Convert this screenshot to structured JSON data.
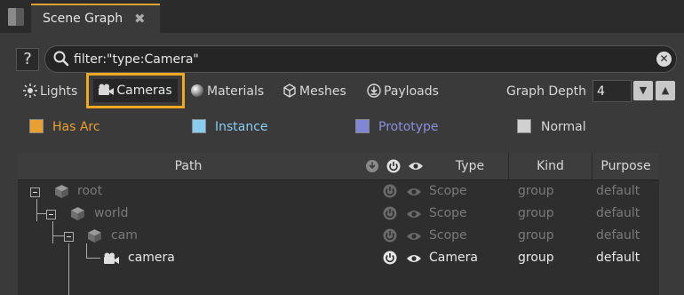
{
  "tab": {
    "title": "Scene Graph",
    "close_glyph": "✖"
  },
  "search": {
    "help_label": "?",
    "value": "filter:\"type:Camera\"",
    "clear_glyph": "✕"
  },
  "filters": [
    {
      "label": "Lights",
      "icon": "light-icon"
    },
    {
      "label": "Cameras",
      "icon": "camera-icon",
      "highlighted": true
    },
    {
      "label": "Materials",
      "icon": "material-sphere-icon"
    },
    {
      "label": "Meshes",
      "icon": "mesh-icon"
    },
    {
      "label": "Payloads",
      "icon": "payload-icon"
    }
  ],
  "graph_depth": {
    "label": "Graph Depth",
    "value": "4",
    "down_glyph": "▼",
    "up_glyph": "▲"
  },
  "legend": [
    {
      "label": "Has Arc",
      "color": "#e8a030",
      "text_color": "#e8a030"
    },
    {
      "label": "Instance",
      "color": "#88ccf0",
      "text_color": "#88ccf0"
    },
    {
      "label": "Prototype",
      "color": "#7f86d6",
      "text_color": "#8a90d8"
    },
    {
      "label": "Normal",
      "color": "#d0d0d0",
      "text_color": "#d8d8d8"
    }
  ],
  "table": {
    "columns": [
      "Path",
      "Type",
      "Kind",
      "Purpose"
    ],
    "rows": [
      {
        "name": "root",
        "type": "Scope",
        "kind": "group",
        "purpose": "default",
        "active": false
      },
      {
        "name": "world",
        "type": "Scope",
        "kind": "group",
        "purpose": "default",
        "active": false
      },
      {
        "name": "cam",
        "type": "Scope",
        "kind": "group",
        "purpose": "default",
        "active": false
      },
      {
        "name": "camera",
        "type": "Camera",
        "kind": "group",
        "purpose": "default",
        "active": true
      }
    ]
  },
  "colors": {
    "accent": "#f0a820",
    "background": "#3a3a3a",
    "table_bg": "#2e2e2e"
  }
}
